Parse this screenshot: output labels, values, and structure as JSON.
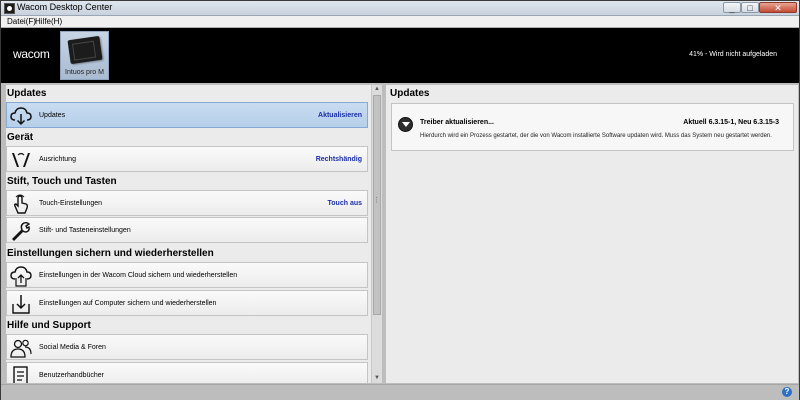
{
  "window": {
    "title": "Wacom Desktop Center"
  },
  "menu": {
    "items": [
      "Datei(F)",
      "Hilfe(H)"
    ]
  },
  "header": {
    "logo": "wacom",
    "device_name": "Intuos pro M",
    "battery_status": "41% - Wird nicht aufgeladen"
  },
  "sections": {
    "updates": "Updates",
    "device": "Gerät",
    "pen": "Stift, Touch und Tasten",
    "backup": "Einstellungen sichern und wiederherstellen",
    "help": "Hilfe und Support"
  },
  "items": {
    "updates": {
      "label": "Updates",
      "value": "Aktualisieren"
    },
    "orientation": {
      "label": "Ausrichtung",
      "value": "Rechtshändig"
    },
    "touch": {
      "label": "Touch-Einstellungen",
      "value": "Touch aus"
    },
    "pen_settings": {
      "label": "Stift- und Tasteneinstellungen"
    },
    "cloud": {
      "label": "Einstellungen in der Wacom Cloud sichern und wiederherstellen"
    },
    "computer": {
      "label": "Einstellungen auf Computer sichern und wiederherstellen"
    },
    "social": {
      "label": "Social Media & Foren"
    },
    "manuals": {
      "label": "Benutzerhandbücher"
    }
  },
  "right": {
    "title": "Updates",
    "card": {
      "title": "Treiber aktualisieren...",
      "version": "Aktuell 6.3.15-1, Neu 6.3.15-3",
      "description": "Hierdurch wird ein Prozess gestartet, der die von Wacom installierte Software updaten wird. Muss das System neu gestartet werden."
    }
  },
  "colors": {
    "accent_link": "#1a2fa8",
    "selected_bg": "#c9dcf1",
    "header_bg": "#000000"
  }
}
